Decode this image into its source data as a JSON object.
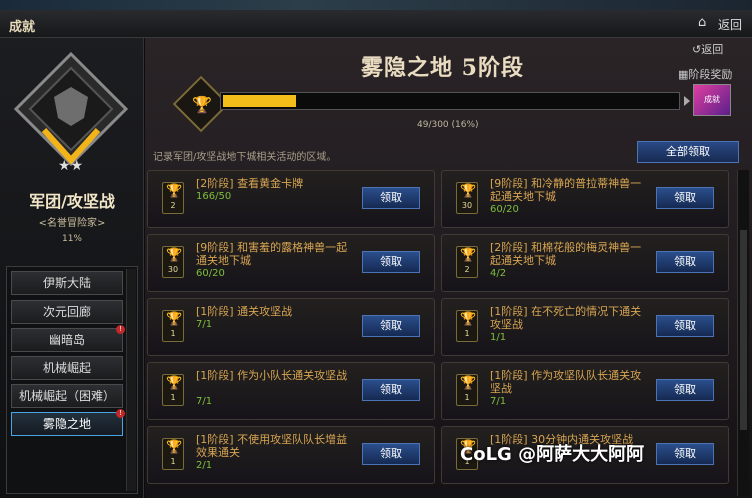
{
  "window": {
    "title": "成就",
    "back_label": "返回"
  },
  "left": {
    "guild_title": "军团/攻坚战",
    "guild_subtitle": "<名誉冒险家>",
    "guild_percent": "11%",
    "nav": [
      {
        "label": "伊斯大陆",
        "alert": false
      },
      {
        "label": "次元回廊",
        "alert": false
      },
      {
        "label": "幽暗岛",
        "alert": true
      },
      {
        "label": "机械崛起",
        "alert": false
      },
      {
        "label": "机械崛起（困难）",
        "alert": false
      },
      {
        "label": "雾隐之地",
        "alert": true,
        "active": true
      }
    ]
  },
  "main": {
    "return_label": "返回",
    "reward_label": "阶段奖励",
    "stage_title": "雾隐之地  5阶段",
    "progress_text": "49/300 (16%)",
    "progress_fraction": 0.16,
    "reward_icon_label": "成就",
    "description": "记录军团/攻坚战地下城相关活动的区域。",
    "claim_all_label": "全部领取",
    "cards": [
      {
        "stage": "2",
        "text": "[2阶段] 查看黄金卡牌",
        "progress": "166/50",
        "button": "领取"
      },
      {
        "stage": "30",
        "text": "[9阶段] 和冷静的普拉蒂神兽一起通关地下城",
        "progress": "60/20",
        "button": "领取"
      },
      {
        "stage": "30",
        "text": "[9阶段] 和害羞的露格神兽一起通关地下城",
        "progress": "60/20",
        "button": "领取"
      },
      {
        "stage": "2",
        "text": "[2阶段] 和棉花般的梅灵神兽一起通关地下城",
        "progress": "4/2",
        "button": "领取"
      },
      {
        "stage": "1",
        "text": "[1阶段] 通关攻坚战",
        "progress": "7/1",
        "button": "领取"
      },
      {
        "stage": "1",
        "text": "[1阶段] 在不死亡的情况下通关攻坚战",
        "progress": "1/1",
        "button": "领取"
      },
      {
        "stage": "1",
        "text": "[1阶段] 作为小队长通关攻坚战",
        "progress": "7/1",
        "button": "领取"
      },
      {
        "stage": "1",
        "text": "[1阶段] 作为攻坚队队长通关攻坚战",
        "progress": "7/1",
        "button": "领取"
      },
      {
        "stage": "1",
        "text": "[1阶段] 不使用攻坚队队长增益效果通关",
        "progress": "2/1",
        "button": "领取"
      },
      {
        "stage": "1",
        "text": "[1阶段] 30分钟内通关攻坚战",
        "progress": "",
        "button": "领取"
      }
    ]
  },
  "watermark": "CoLG @阿萨大大阿阿",
  "colors": {
    "accent_blue": "#2b4e8c",
    "progress_yellow": "#f3be1a",
    "progress_green": "#7fbf3c",
    "task_orange": "#d8a552"
  },
  "icons": [
    "home-icon",
    "trophy-icon",
    "return-icon",
    "reward-icon"
  ]
}
